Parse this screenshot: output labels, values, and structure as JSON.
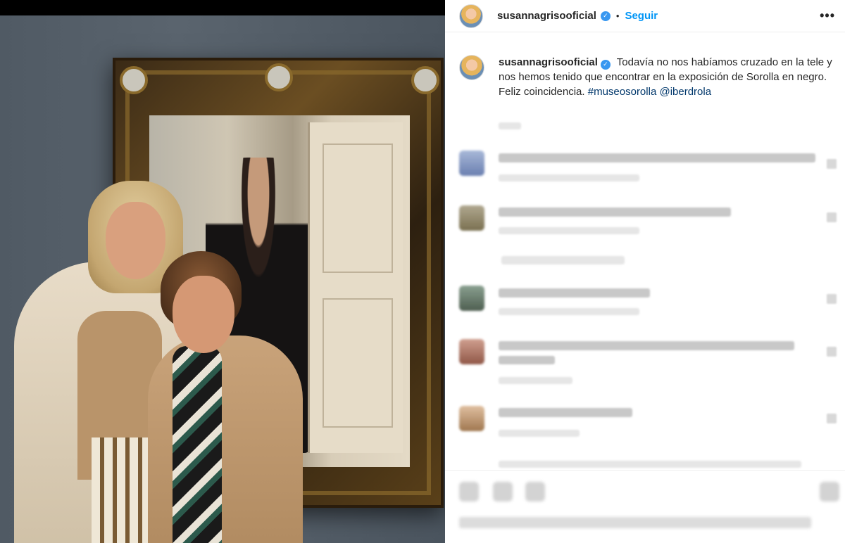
{
  "post": {
    "username": "susannagrisooficial",
    "separator": "•",
    "follow_label": "Seguir",
    "more_label": "•••",
    "verified_glyph": "✓",
    "caption_text": "Todavía no nos habíamos cruzado en la tele y nos hemos tenido que encontrar en la exposición de Sorolla en negro. Feliz coincidencia.",
    "hashtag": "#museosorolla",
    "mention": "@iberdrola"
  },
  "icons": {
    "verified": "verified-badge-icon",
    "more": "more-options-icon",
    "like": "heart-icon",
    "comment": "comment-icon",
    "share": "share-icon",
    "save": "bookmark-icon"
  },
  "colors": {
    "follow": "#0095f6",
    "verified": "#3897f0",
    "link": "#00376b",
    "text": "#262626"
  }
}
